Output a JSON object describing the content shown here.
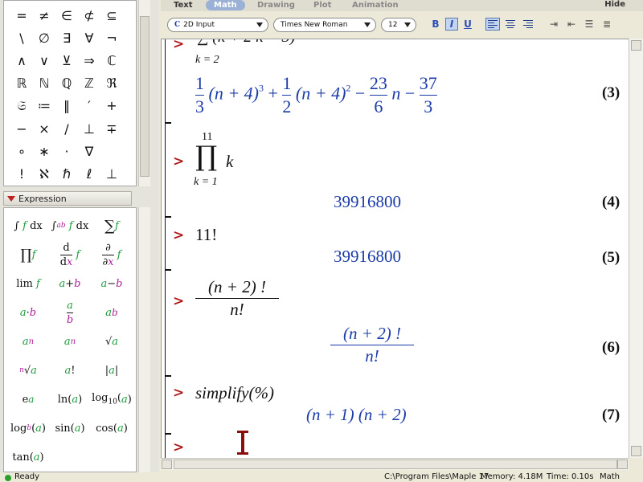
{
  "palette": {
    "symbols": [
      "=",
      "≠",
      "∈",
      "⊄",
      "⊆",
      "\\",
      "∅",
      "∃",
      "∀",
      "¬",
      "∧",
      "∨",
      "⊻",
      "⇒",
      "ℂ",
      "ℝ",
      "ℕ",
      "ℚ",
      "ℤ",
      "ℜ",
      "𝔖",
      "≔",
      "‖",
      "′",
      "+",
      "−",
      "×",
      "/",
      "⊥",
      "∓",
      "∘",
      "∗",
      "·",
      "∇",
      "",
      "!",
      "ℵ",
      "ℏ",
      "ℓ",
      "⊥"
    ],
    "expression_title": "Expression",
    "expressions": [
      "∫ f dx",
      "∫ₐᵇ f dx",
      "∑ f",
      "∏ f",
      "d/dx f",
      "∂/∂x f",
      "lim f",
      "a + b",
      "a − b",
      "a·b",
      "a/b",
      "aᵇ",
      "aₙ",
      "aₙ",
      "√a",
      "ⁿ√a",
      "a!",
      "|a|",
      "eᵃ",
      "ln(a)",
      "log₁₀(a)",
      "log_b(a)",
      "sin(a)",
      "cos(a)",
      "tan(a)"
    ]
  },
  "modes": [
    "Text",
    "Math",
    "Drawing",
    "Plot",
    "Animation"
  ],
  "active_mode": "Math",
  "hide_label": "Hide",
  "toolbar": {
    "input_mode": "2D Input",
    "font": "Times New Roman",
    "size": "12",
    "bold": "B",
    "italic": "I",
    "underline": "U"
  },
  "document": {
    "partial_top": "k = 2",
    "out3": {
      "a": "1",
      "b": "3",
      "c": "(n + 4)",
      "d": "3",
      "e": "1",
      "f": "2",
      "g": "(n + 4)",
      "h": "2",
      "i": "23",
      "j": "6",
      "k": "n",
      "l": "37",
      "m": "3"
    },
    "label3": "(3)",
    "in4_upper": "11",
    "in4_lower": "k = 1",
    "in4_body": "k",
    "out4": "39916800",
    "label4": "(4)",
    "in5": "11!",
    "out5": "39916800",
    "label5": "(5)",
    "in6_num": "(n + 2) !",
    "in6_den": "n!",
    "out6_num": "(n + 2) !",
    "out6_den": "n!",
    "label6": "(6)",
    "in7": "simplify(%)",
    "out7": "(n + 1) (n + 2)",
    "label7": "(7)",
    "prompt": ">"
  },
  "status": {
    "ready": "Ready",
    "path": "C:\\Program Files\\Maple 17",
    "memory": "Memory: 4.18M",
    "time": "Time: 0.10s",
    "mode": "Math Mode"
  }
}
